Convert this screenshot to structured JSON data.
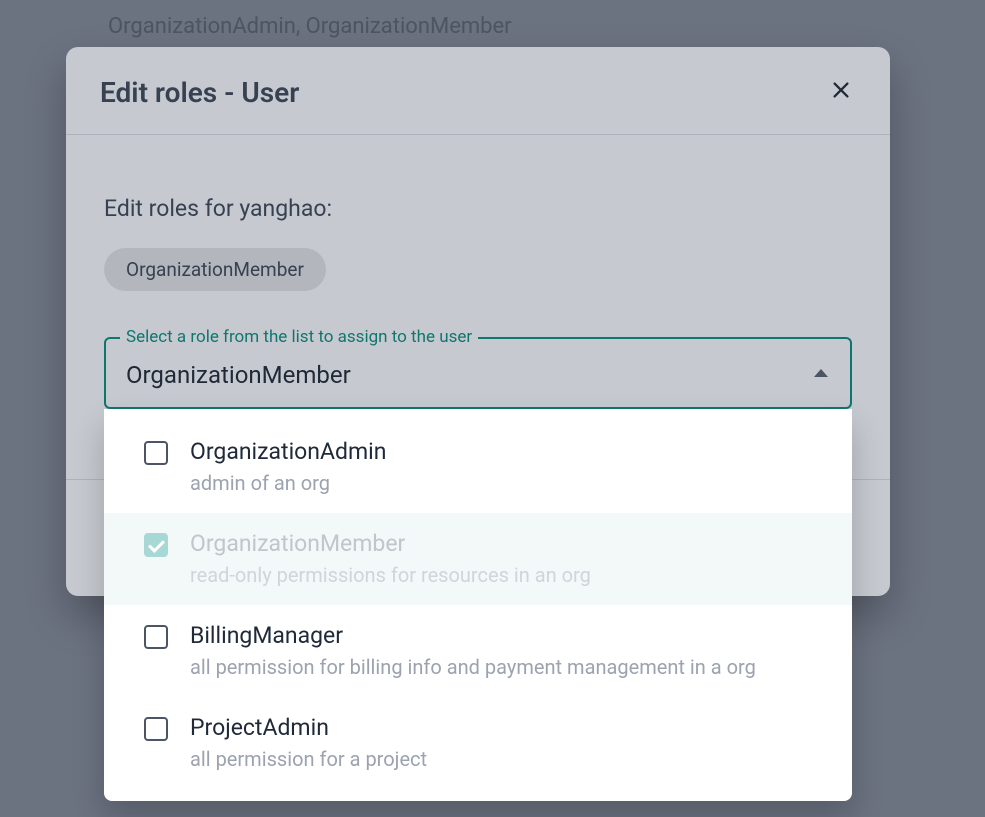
{
  "background_text": "OrganizationAdmin, OrganizationMember",
  "modal": {
    "title": "Edit roles - User",
    "subtitle": "Edit roles for yanghao:",
    "current_role_chip": "OrganizationMember",
    "select": {
      "legend": "Select a role from the list to assign to the user",
      "value": "OrganizationMember",
      "options": [
        {
          "label": "OrganizationAdmin",
          "desc": "admin of an org",
          "checked": false,
          "highlighted": false
        },
        {
          "label": "OrganizationMember",
          "desc": "read-only permissions for resources in an org",
          "checked": true,
          "highlighted": true
        },
        {
          "label": "BillingManager",
          "desc": "all permission for billing info and payment management in a org",
          "checked": false,
          "highlighted": false
        },
        {
          "label": "ProjectAdmin",
          "desc": "all permission for a project",
          "checked": false,
          "highlighted": false
        }
      ]
    }
  }
}
